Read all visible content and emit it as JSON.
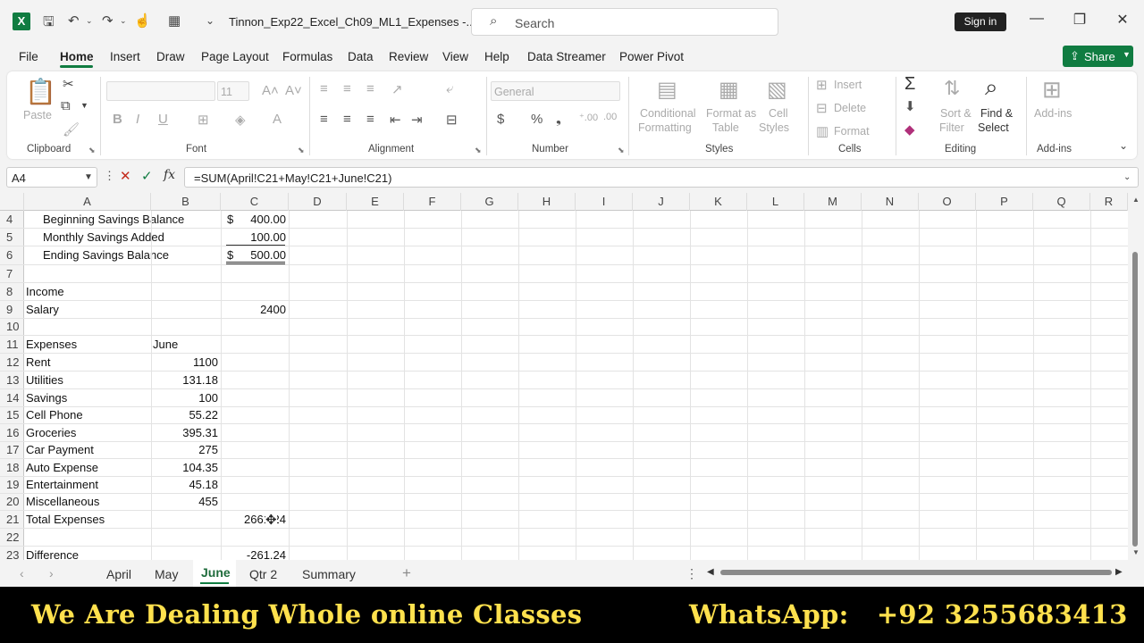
{
  "app": {
    "title": "Tinnon_Exp22_Excel_Ch09_ML1_Expenses  -...",
    "logo": "X"
  },
  "search": {
    "placeholder": "Search"
  },
  "signin": "Sign in",
  "menu": [
    "File",
    "Home",
    "Insert",
    "Draw",
    "Page Layout",
    "Formulas",
    "Data",
    "Review",
    "View",
    "Help",
    "Data Streamer",
    "Power Pivot"
  ],
  "share": "Share",
  "ribbon": {
    "clipboard": {
      "label": "Clipboard",
      "paste": "Paste"
    },
    "font": {
      "label": "Font",
      "size": "11"
    },
    "alignment": {
      "label": "Alignment"
    },
    "number": {
      "label": "Number",
      "format": "General"
    },
    "styles": {
      "label": "Styles",
      "conditional": [
        "Conditional",
        "Formatting"
      ],
      "format_table": [
        "Format as",
        "Table"
      ],
      "cell_styles": [
        "Cell",
        "Styles"
      ]
    },
    "cells": {
      "label": "Cells",
      "insert": "Insert",
      "delete": "Delete",
      "format": "Format"
    },
    "editing": {
      "label": "Editing",
      "sort": [
        "Sort &",
        "Filter"
      ],
      "find": [
        "Find &",
        "Select"
      ]
    },
    "addins": {
      "label": "Add-ins",
      "btn": "Add-ins"
    }
  },
  "formula_bar": {
    "name_box": "A4",
    "formula": "=SUM(April!C21+May!C21+June!C21)"
  },
  "columns": [
    "A",
    "B",
    "C",
    "D",
    "E",
    "F",
    "G",
    "H",
    "I",
    "J",
    "K",
    "L",
    "M",
    "N",
    "O",
    "P",
    "Q",
    "R"
  ],
  "rows": [
    {
      "n": "4",
      "a": "Beginning Savings Balance",
      "indent": true,
      "c_cur": "$",
      "c": "400.00"
    },
    {
      "n": "5",
      "a": "Monthly Savings Added",
      "indent": true,
      "c": "100.00"
    },
    {
      "n": "6",
      "a": "Ending Savings Balance",
      "indent": true,
      "c_cur": "$",
      "c": "500.00"
    },
    {
      "n": "7"
    },
    {
      "n": "8",
      "a": "Income"
    },
    {
      "n": "9",
      "a": "Salary",
      "c": "2400"
    },
    {
      "n": "10"
    },
    {
      "n": "11",
      "a": "Expenses",
      "b": "June"
    },
    {
      "n": "12",
      "a": "Rent",
      "b": "1100"
    },
    {
      "n": "13",
      "a": "Utilities",
      "b": "131.18"
    },
    {
      "n": "14",
      "a": "Savings",
      "b": "100"
    },
    {
      "n": "15",
      "a": "Cell Phone",
      "b": "55.22"
    },
    {
      "n": "16",
      "a": "Groceries",
      "b": "395.31"
    },
    {
      "n": "17",
      "a": "Car Payment",
      "b": "275"
    },
    {
      "n": "18",
      "a": "Auto Expense",
      "b": "104.35"
    },
    {
      "n": "19",
      "a": "Entertainment",
      "b": "45.18"
    },
    {
      "n": "20",
      "a": "Miscellaneous",
      "b": "455"
    },
    {
      "n": "21",
      "a": "Total Expenses",
      "c": "2661.24"
    },
    {
      "n": "22"
    },
    {
      "n": "23",
      "a": "Difference",
      "c": "-261.24"
    }
  ],
  "sheets": [
    "April",
    "May",
    "June",
    "Qtr 2",
    "Summary"
  ],
  "active_sheet": "June",
  "banner": {
    "left": "We Are Dealing Whole online Classes",
    "right": "WhatsApp:   +92 3255683413",
    "color": "#ffe14d"
  },
  "colors": {
    "accent": "#107c41"
  }
}
